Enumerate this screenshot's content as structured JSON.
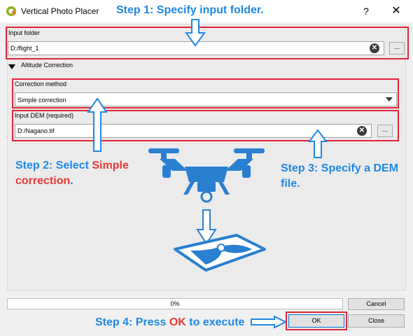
{
  "window": {
    "title": "Vertical Photo Placer",
    "help": "?",
    "close": "✕"
  },
  "annotations": {
    "step1": "Step 1: Specify input folder.",
    "step2_a": "Step 2: Select ",
    "step2_b": "Simple",
    "step2_c": "correction",
    "step2_d": ".",
    "step3_a": "Step 3: Specify a DEM",
    "step3_b": "file.",
    "step4_a": "Step 4: Press ",
    "step4_b": "OK",
    "step4_c": " to execute"
  },
  "input_folder": {
    "label": "Input folder",
    "value": "D:/flight_1",
    "browse": "..."
  },
  "altitude_correction": {
    "label": "Altitude Correction"
  },
  "correction_method": {
    "label": "Correction method",
    "selected": "Simple correction"
  },
  "input_dem": {
    "label": "Input DEM (required)",
    "value": "D:/Nagano.tif",
    "browse": "..."
  },
  "progress": {
    "value": 0,
    "text": "0%"
  },
  "buttons": {
    "cancel": "Cancel",
    "ok": "OK",
    "close": "Close"
  },
  "colors": {
    "annotation_blue": "#1e88e5",
    "annotation_red": "#e53935",
    "highlight_box": "#e0263a",
    "drone": "#2a7fd0"
  }
}
